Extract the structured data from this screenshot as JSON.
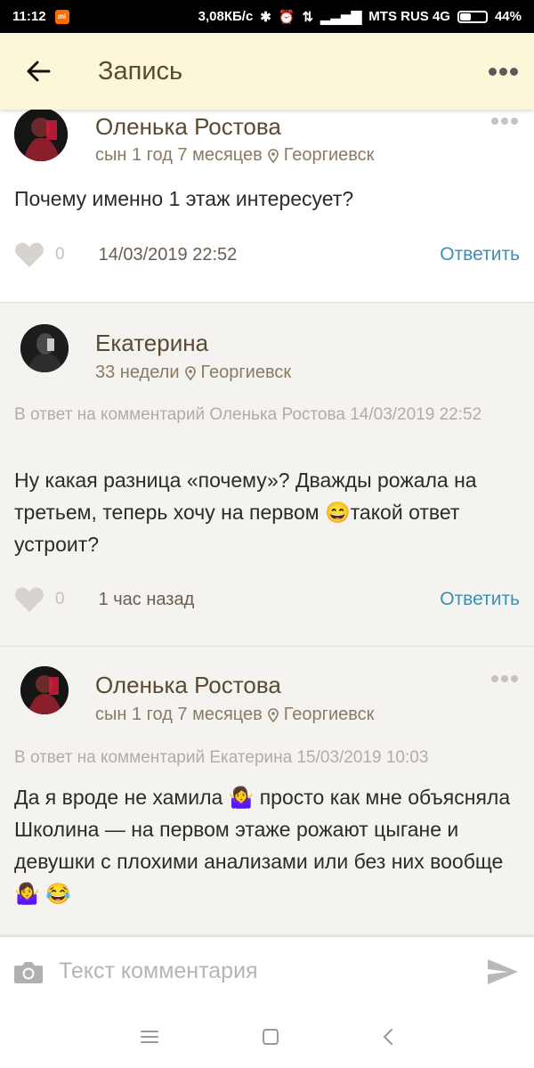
{
  "status": {
    "time": "11:12",
    "speed": "3,08КБ/с",
    "carrier": "MTS RUS 4G",
    "battery": "44%",
    "battery_level": 0.44
  },
  "header": {
    "title": "Запись"
  },
  "comments": [
    {
      "author": "Оленька Ростова",
      "age": "сын 1 год 7 месяцев",
      "city": "Георгиевск",
      "reply_to": "",
      "text": "Почему именно 1 этаж интересует?",
      "likes": "0",
      "time": "14/03/2019 22:52",
      "reply_label": "Ответить"
    },
    {
      "author": "Екатерина",
      "age": "33 недели",
      "city": "Георгиевск",
      "reply_to": "В ответ на комментарий Оленька Ростова 14/03/2019 22:52",
      "text": "Ну какая разница «почему»? Дважды рожала на третьем, теперь хочу на первом 😄такой ответ устроит?",
      "likes": "0",
      "time": "1 час назад",
      "reply_label": "Ответить"
    },
    {
      "author": "Оленька Ростова",
      "age": "сын 1 год 7 месяцев",
      "city": "Георгиевск",
      "reply_to": "В ответ на комментарий Екатерина  15/03/2019 10:03",
      "text": "Да я вроде не хамила 🤷‍♀️ просто как мне объясняла Школина — на первом этаже рожают цыгане и девушки с плохими анализами или без них вообще🤷‍♀️ 😂"
    }
  ],
  "composer": {
    "placeholder": "Текст комментария"
  },
  "colors": {
    "appbar_bg": "#fcf7d8",
    "accent_link": "#3a8fb7",
    "author_text": "#5a4a32"
  }
}
